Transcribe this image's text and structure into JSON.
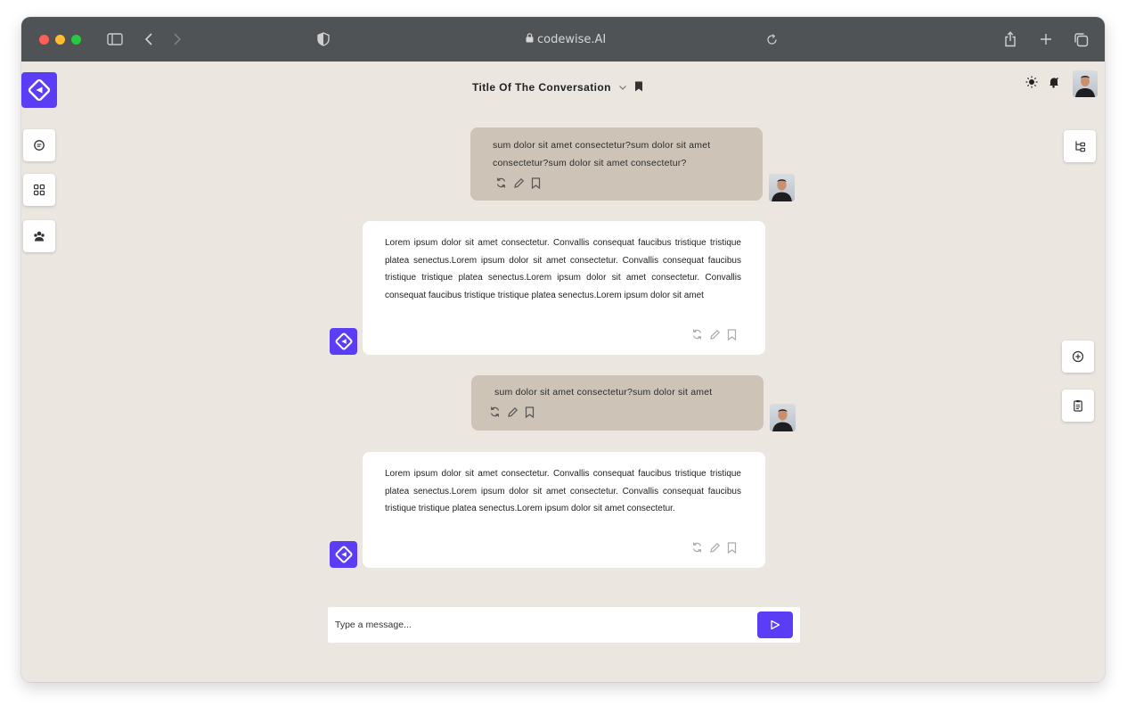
{
  "browser": {
    "url": "codewise.AI"
  },
  "colors": {
    "accent": "#5b3df5",
    "user_bubble": "#cdc3b7",
    "background": "#ebe6e0",
    "titlebar": "#505356"
  },
  "header": {
    "conversation_title": "Title Of The Conversation"
  },
  "messages": [
    {
      "role": "user",
      "text": "sum dolor sit amet consectetur?sum dolor sit amet consectetur?sum dolor sit amet consectetur?"
    },
    {
      "role": "assistant",
      "text": "Lorem ipsum dolor sit amet consectetur. Convallis consequat faucibus tristique tristique platea senectus.Lorem ipsum dolor sit amet consectetur. Convallis consequat faucibus tristique tristique platea senectus.Lorem ipsum dolor sit amet consectetur. Convallis consequat faucibus tristique tristique platea senectus.Lorem ipsum dolor sit amet"
    },
    {
      "role": "user",
      "text": "sum dolor sit amet consectetur?sum dolor sit amet"
    },
    {
      "role": "assistant",
      "text": "Lorem ipsum dolor sit amet consectetur. Convallis consequat faucibus tristique tristique platea senectus.Lorem ipsum dolor sit amet consectetur. Convallis consequat faucibus tristique tristique platea senectus.Lorem ipsum dolor sit amet consectetur."
    }
  ],
  "composer": {
    "placeholder": "Type a message..."
  },
  "icons": {
    "left_sidebar": [
      "chat-icon",
      "grid-icon",
      "community-icon"
    ],
    "right_sidebar": [
      "tree-icon",
      "add-circle-icon",
      "clipboard-icon"
    ],
    "message_actions": [
      "regenerate-icon",
      "edit-icon",
      "bookmark-icon"
    ],
    "header_right": [
      "sun-icon",
      "notification-bell-icon",
      "user-avatar"
    ]
  }
}
